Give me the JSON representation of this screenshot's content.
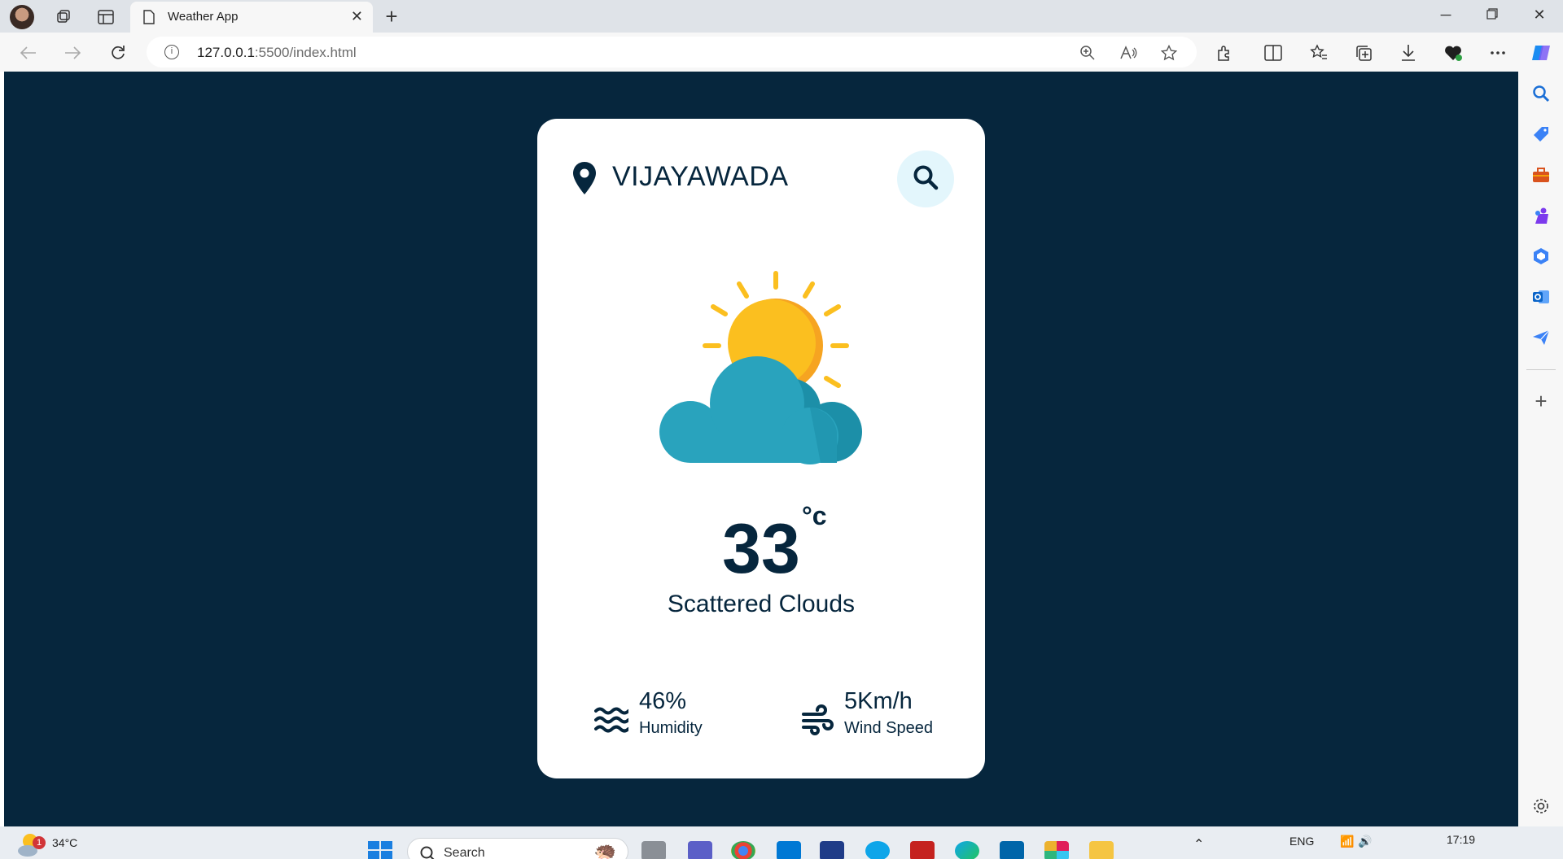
{
  "browser": {
    "tab_title": "Weather App",
    "url_host": "127.0.0.1",
    "url_rest": ":5500/index.html"
  },
  "app": {
    "city": "VIJAYAWADA",
    "temperature": "33",
    "unit": "°c",
    "description": "Scattered Clouds",
    "humidity_value": "46%",
    "humidity_label": "Humidity",
    "wind_value": "5Km/h",
    "wind_label": "Wind Speed",
    "colors": {
      "background": "#06263d",
      "card": "#ffffff",
      "accent": "#e3f6fc"
    },
    "icons": [
      "location-pin-icon",
      "search-icon",
      "sun-cloud-icon",
      "humidity-icon",
      "wind-icon"
    ]
  },
  "taskbar": {
    "weather_temp": "34°C",
    "notification_count": "1",
    "search_placeholder": "Search",
    "language": "ENG",
    "time": "17:19"
  }
}
